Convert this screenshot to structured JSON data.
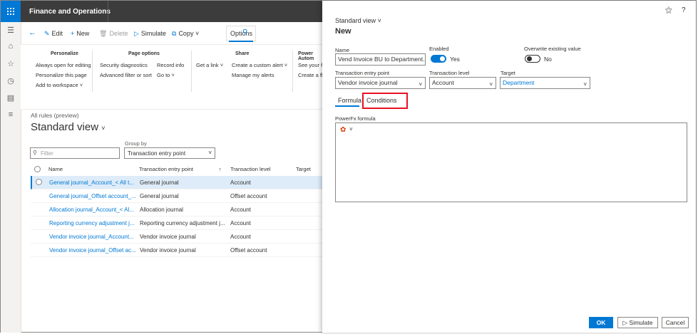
{
  "app": {
    "title": "Finance and Operations"
  },
  "actions": {
    "edit": "Edit",
    "new": "New",
    "delete": "Delete",
    "simulate": "Simulate",
    "copy": "Copy",
    "options": "Options"
  },
  "ribbon": {
    "groups": [
      {
        "header": "Personalize",
        "items": [
          "Always open for editing",
          "Personalize this page",
          "Add to workspace"
        ]
      },
      {
        "header": "Page options",
        "items": [
          "Security diagnostics",
          "Advanced filter or sort",
          "Record info",
          "Go to"
        ]
      },
      {
        "header": "Share",
        "items": [
          "Get a link",
          "Create a custom alert",
          "Manage my alerts"
        ]
      },
      {
        "header": "Power Autom",
        "items": [
          "See your fl",
          "Create a flo"
        ]
      }
    ]
  },
  "list": {
    "breadcrumb": "All rules (preview)",
    "view_name": "Standard view",
    "filter_placeholder": "Filter",
    "group_by_label": "Group by",
    "group_by_value": "Transaction entry point",
    "columns": [
      "Name",
      "Transaction entry point",
      "Transaction level",
      "Target"
    ],
    "rows": [
      {
        "name": "General journal_Account_< All t...",
        "entry": "General journal",
        "level": "Account"
      },
      {
        "name": "General journal_Offset account_...",
        "entry": "General journal",
        "level": "Offset account"
      },
      {
        "name": "Allocation journal_Account_< Al...",
        "entry": "Allocation journal",
        "level": "Account"
      },
      {
        "name": "Reporting currency adjustment j...",
        "entry": "Reporting currency adjustment j...",
        "level": "Account"
      },
      {
        "name": "Vendor invoice journal_Account...",
        "entry": "Vendor invoice journal",
        "level": "Account"
      },
      {
        "name": "Vendor invoice journal_Offset ac...",
        "entry": "Vendor invoice journal",
        "level": "Offset account"
      }
    ]
  },
  "panel": {
    "view_label": "Standard view",
    "title": "New",
    "name_label": "Name",
    "name_value": "Vend Invoice BU to Department...",
    "enabled_label": "Enabled",
    "enabled_value": "Yes",
    "overwrite_label": "Overwrite existing value",
    "overwrite_value": "No",
    "entry_label": "Transaction entry point",
    "entry_value": "Vendor invoice journal",
    "level_label": "Transaction level",
    "level_value": "Account",
    "target_label": "Target",
    "target_value": "Department",
    "tabs": [
      "Formula",
      "Conditions"
    ],
    "formula_label": "PowerFx formula",
    "buttons": {
      "ok": "OK",
      "simulate": "Simulate",
      "cancel": "Cancel"
    }
  },
  "colors": {
    "accent": "#0078d4",
    "highlight": "#e81123",
    "topbar": "#3c3c3c"
  }
}
